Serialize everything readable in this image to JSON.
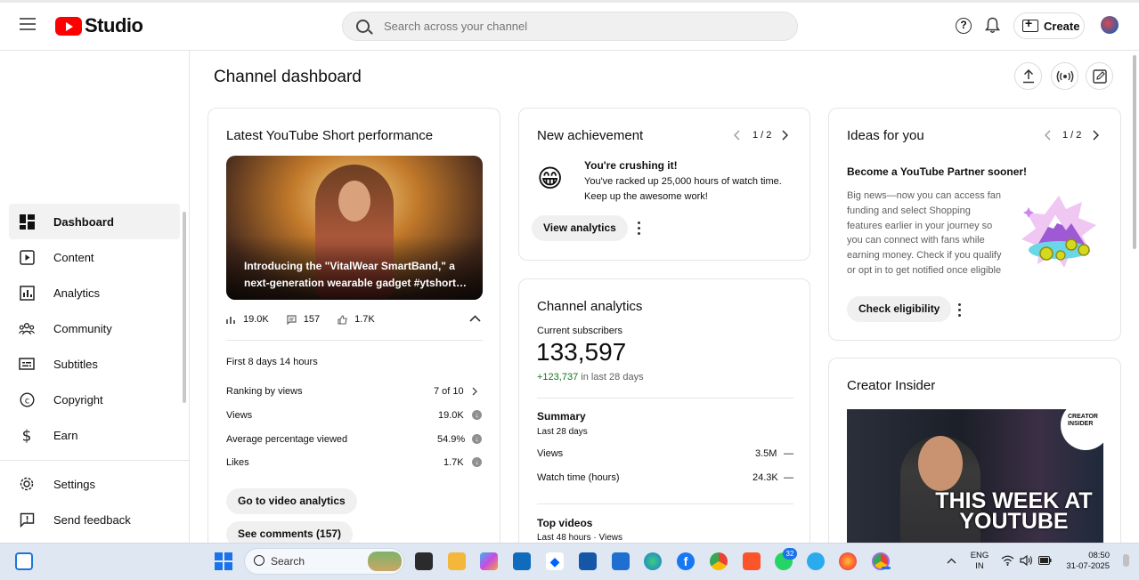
{
  "app": {
    "logo_text": "Studio"
  },
  "search": {
    "placeholder": "Search across your channel"
  },
  "header": {
    "create_label": "Create"
  },
  "sidebar": {
    "items": [
      {
        "label": "Dashboard",
        "icon": "dashboard-icon",
        "active": true
      },
      {
        "label": "Content",
        "icon": "content-icon"
      },
      {
        "label": "Analytics",
        "icon": "analytics-icon"
      },
      {
        "label": "Community",
        "icon": "community-icon"
      },
      {
        "label": "Subtitles",
        "icon": "subtitles-icon"
      },
      {
        "label": "Copyright",
        "icon": "copyright-icon"
      },
      {
        "label": "Earn",
        "icon": "earn-icon"
      },
      {
        "label": "Settings",
        "icon": "gear-icon"
      },
      {
        "label": "Send feedback",
        "icon": "feedback-icon"
      }
    ]
  },
  "main": {
    "title": "Channel dashboard"
  },
  "short_card": {
    "title": "Latest YouTube Short performance",
    "caption": "Introducing the \"VitalWear SmartBand,\" a next-generation wearable gadget #ytshort…",
    "views": "19.0K",
    "comments": "157",
    "likes": "1.7K",
    "period": "First 8 days 14 hours",
    "rows": [
      {
        "label": "Ranking by views",
        "value": "7 of 10"
      },
      {
        "label": "Views",
        "value": "19.0K"
      },
      {
        "label": "Average percentage viewed",
        "value": "54.9%"
      },
      {
        "label": "Likes",
        "value": "1.7K"
      }
    ],
    "analytics_btn": "Go to video analytics",
    "comments_btn": "See comments (157)"
  },
  "achievement_card": {
    "title": "New achievement",
    "pager": "1 / 2",
    "emoji": "😁",
    "heading": "You're crushing it!",
    "body_line1": "You've racked up 25,000 hours of watch time.",
    "body_line2": "Keep up the awesome work!",
    "button": "View analytics"
  },
  "analytics_card": {
    "title": "Channel analytics",
    "subs_label": "Current subscribers",
    "subs_value": "133,597",
    "subs_delta": "+123,737",
    "subs_delta_suffix": "in last 28 days",
    "summary_title": "Summary",
    "summary_period": "Last 28 days",
    "rows": [
      {
        "label": "Views",
        "value": "3.5M",
        "trend": "—"
      },
      {
        "label": "Watch time (hours)",
        "value": "24.3K",
        "trend": "—"
      }
    ],
    "top_title": "Top videos",
    "top_sub": "Last 48 hours · Views"
  },
  "ideas_card": {
    "title": "Ideas for you",
    "pager": "1 / 2",
    "heading": "Become a YouTube Partner sooner!",
    "body": "Big news—now you can access fan funding and select Shopping features earlier in your journey so you can connect with fans while earning money. Check if you qualify or opt in to get notified once eligible",
    "button": "Check eligibility"
  },
  "insider_card": {
    "title": "Creator Insider",
    "badge": "CREATOR INSIDER",
    "thumb_text": "THIS WEEK AT YOUTUBE"
  },
  "taskbar": {
    "search_label": "Search",
    "lang_line1": "ENG",
    "lang_line2": "IN",
    "time": "08:50",
    "date": "31-07-2025",
    "whatsapp_badge": "32"
  },
  "colors": {
    "brand_red": "#ff0000",
    "positive_green": "#107516"
  }
}
